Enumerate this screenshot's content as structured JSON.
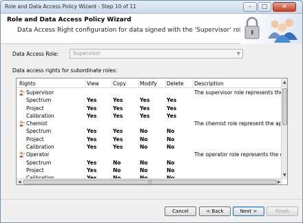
{
  "window": {
    "title": "Role and Data Access Policy Wizard - Step 10 of 11",
    "controls": {
      "minimize": "–",
      "maximize": "□",
      "close": "✕"
    }
  },
  "header": {
    "title": "Role and Data Access Policy Wizard",
    "subtitle": "Data Access Right configuration for data signed with the 'Supervisor' role",
    "icons": [
      "padlock-icon",
      "users-icon"
    ]
  },
  "form": {
    "role_label": "Data Access Role:",
    "role_value": "Supervisor",
    "grid_label": "Data access rights for subordinate roles:"
  },
  "grid": {
    "columns": [
      "Rights",
      "View",
      "Copy",
      "Modify",
      "Delete",
      "Description"
    ],
    "rows": [
      {
        "type": "role",
        "name": "Supervisor",
        "description": "The supervisor role represents the superv..."
      },
      {
        "type": "right",
        "name": "Spectrum",
        "view": "Yes",
        "copy": "Yes",
        "modify": "Yes",
        "delete": "Yes"
      },
      {
        "type": "right",
        "name": "Project",
        "view": "Yes",
        "copy": "Yes",
        "modify": "Yes",
        "delete": "Yes"
      },
      {
        "type": "right",
        "name": "Calibration",
        "view": "Yes",
        "copy": "Yes",
        "modify": "Yes",
        "delete": "Yes"
      },
      {
        "type": "role",
        "name": "Chemist",
        "description": "The chemist role represent the applicatio..."
      },
      {
        "type": "right",
        "name": "Spectrum",
        "view": "Yes",
        "copy": "Yes",
        "modify": "No",
        "delete": "No"
      },
      {
        "type": "right",
        "name": "Project",
        "view": "Yes",
        "copy": "Yes",
        "modify": "No",
        "delete": "No"
      },
      {
        "type": "right",
        "name": "Calibration",
        "view": "Yes",
        "copy": "Yes",
        "modify": "No",
        "delete": "No"
      },
      {
        "type": "role",
        "name": "Operator",
        "description": "The operator role represents the default l..."
      },
      {
        "type": "right",
        "name": "Spectrum",
        "view": "Yes",
        "copy": "No",
        "modify": "No",
        "delete": "No"
      },
      {
        "type": "right",
        "name": "Project",
        "view": "Yes",
        "copy": "No",
        "modify": "No",
        "delete": "No"
      },
      {
        "type": "right",
        "name": "Calibration",
        "view": "Yes",
        "copy": "No",
        "modify": "No",
        "delete": "No"
      }
    ]
  },
  "buttons": {
    "cancel": "Cancel",
    "back": "< Back",
    "next": "Next >",
    "finish": "Finish"
  },
  "colors": {
    "accent": "#3c7fb1",
    "disabled_text": "#9a9a9a"
  }
}
